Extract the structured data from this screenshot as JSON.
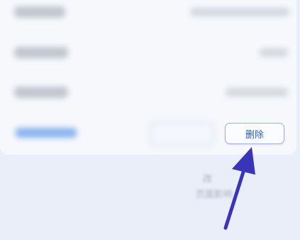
{
  "dialog": {
    "delete_label": "删除",
    "footer_line_1": "改",
    "footer_line_2": "页面影响"
  },
  "colors": {
    "accent": "#2a5bd7",
    "annotation_arrow": "#3a35b8"
  }
}
